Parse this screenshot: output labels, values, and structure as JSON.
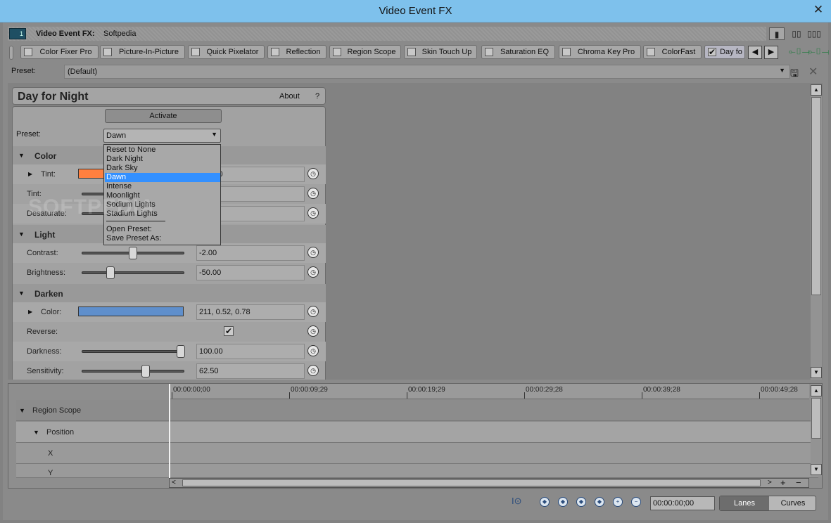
{
  "window": {
    "title": "Video Event FX",
    "close_glyph": "✕"
  },
  "header": {
    "label": "Video Event FX:",
    "value": "Softpedia",
    "badge": "1"
  },
  "tabs": [
    {
      "label": "Color Fixer Pro",
      "checked": false
    },
    {
      "label": "Picture-In-Picture",
      "checked": false
    },
    {
      "label": "Quick Pixelator",
      "checked": false
    },
    {
      "label": "Reflection",
      "checked": false
    },
    {
      "label": "Region Scope",
      "checked": false
    },
    {
      "label": "Skin Touch Up",
      "checked": false
    },
    {
      "label": "Saturation EQ",
      "checked": false
    },
    {
      "label": "Chroma Key Pro",
      "checked": false
    },
    {
      "label": "ColorFast",
      "checked": false
    },
    {
      "label": "Day fo",
      "checked": true
    }
  ],
  "preset": {
    "label": "Preset:",
    "value": "(Default)"
  },
  "panel": {
    "title": "Day for Night",
    "about": "About",
    "help": "?",
    "activate": "Activate",
    "preset_label": "Preset:",
    "preset_value": "Dawn",
    "dropdown": [
      "Reset to None",
      "Dark Night",
      "Dark Sky",
      "Dawn",
      "Intense",
      "Moonlight",
      "Sodium Lights",
      "Stadium Lights",
      "Open Preset:",
      "Save Preset As:"
    ],
    "dropdown_selected": "Dawn",
    "sections": {
      "color": "Color",
      "light": "Light",
      "darken": "Darken"
    },
    "params": {
      "tint1": {
        "label": "Tint:",
        "value": "75, 1.0",
        "swatch": "#ff8040"
      },
      "tint2": {
        "label": "Tint:",
        "value": ""
      },
      "desaturate": {
        "label": "Desaturate:",
        "value": ""
      },
      "contrast": {
        "label": "Contrast:",
        "value": "-2.00",
        "level": 0.49
      },
      "brightness": {
        "label": "Brightness:",
        "value": "-50.00",
        "level": 0.25
      },
      "dcolor": {
        "label": "Color:",
        "value": "211, 0.52, 0.78",
        "swatch": "#5f8fcc"
      },
      "reverse": {
        "label": "Reverse:",
        "checked": true
      },
      "darkness": {
        "label": "Darkness:",
        "value": "100.00",
        "level": 1.0
      },
      "sensitivity": {
        "label": "Sensitivity:",
        "value": "62.50",
        "level": 0.625
      }
    }
  },
  "timeline": {
    "ruler": [
      "00:00:00;00",
      "00:00:09;29",
      "00:00:19;29",
      "00:00:29;28",
      "00:00:39;28",
      "00:00:49;28"
    ],
    "tracks": {
      "region": "Region Scope",
      "position": "Position",
      "x": "X",
      "y": "Y"
    }
  },
  "bottom": {
    "timecode": "00:00:00;00",
    "lanes": "Lanes",
    "curves": "Curves"
  },
  "watermark": "SOFTPEDIA"
}
